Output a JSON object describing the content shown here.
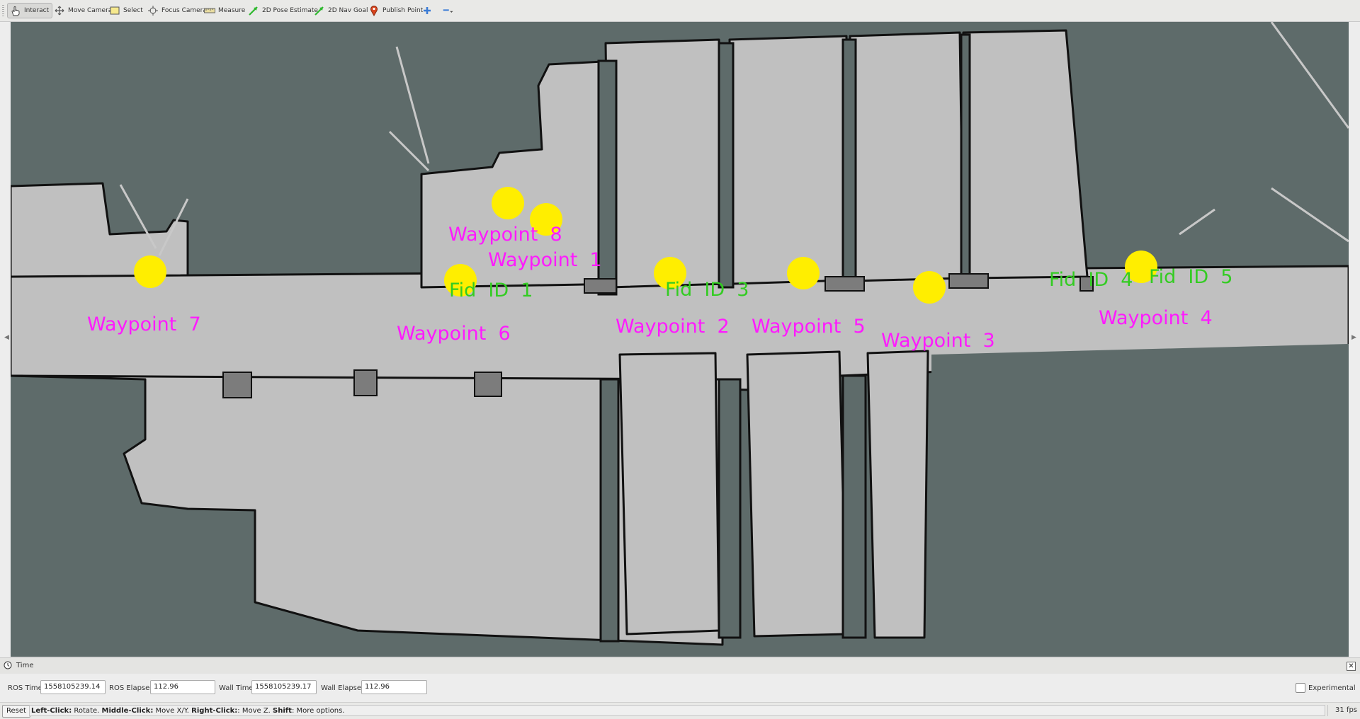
{
  "toolbar": {
    "tools": [
      {
        "label": "Interact",
        "icon": "hand-cursor-icon",
        "active": true
      },
      {
        "label": "Move Camera",
        "icon": "move-arrows-icon"
      },
      {
        "label": "Select",
        "icon": "select-box-icon"
      },
      {
        "label": "Focus Camera",
        "icon": "focus-crosshair-icon"
      },
      {
        "label": "Measure",
        "icon": "ruler-icon"
      },
      {
        "label": "2D Pose Estimate",
        "icon": "green-arrow-icon"
      },
      {
        "label": "2D Nav Goal",
        "icon": "green-arrow-icon"
      },
      {
        "label": "Publish Point",
        "icon": "map-pin-icon"
      }
    ],
    "add_tool_icon": "plus-icon",
    "remove_tool_icon": "minus-dropdown-icon"
  },
  "viewport": {
    "background_color": "#5e6b6a",
    "free_space_color": "#c0c0c0",
    "wall_color": "#111111",
    "waypoint_color": "#ff1aff",
    "waypoint_marker_color": "#ffee00",
    "fiducial_color": "#33cc22",
    "waypoints": [
      {
        "label": "Waypoint  8"
      },
      {
        "label": "Waypoint  1"
      },
      {
        "label": "Waypoint  7"
      },
      {
        "label": "Waypoint  6"
      },
      {
        "label": "Waypoint  2"
      },
      {
        "label": "Waypoint  5"
      },
      {
        "label": "Waypoint  3"
      },
      {
        "label": "Waypoint  4"
      }
    ],
    "fiducials": [
      {
        "label": "Fid  ID  1"
      },
      {
        "label": "Fid  ID  3"
      },
      {
        "label": "Fid  ID  4"
      },
      {
        "label": "Fid  ID  5"
      }
    ]
  },
  "time_panel": {
    "title": "Time",
    "ros_time_label": "ROS Time:",
    "ros_time_value": "1558105239.14",
    "ros_elapsed_label": "ROS Elapsed:",
    "ros_elapsed_value": "112.96",
    "wall_time_label": "Wall Time:",
    "wall_time_value": "1558105239.17",
    "wall_elapsed_label": "Wall Elapsed:",
    "wall_elapsed_value": "112.96",
    "experimental_label": "Experimental",
    "experimental_checked": false
  },
  "status_bar": {
    "reset_label": "Reset",
    "hint_left_click": "Left-Click:",
    "hint_left_action": " Rotate. ",
    "hint_middle_click": "Middle-Click:",
    "hint_middle_action": " Move X/Y. ",
    "hint_right_click": "Right-Click:",
    "hint_right_action": ": Move Z. ",
    "hint_shift": "Shift",
    "hint_shift_action": ": More options.",
    "fps": "31 fps"
  }
}
